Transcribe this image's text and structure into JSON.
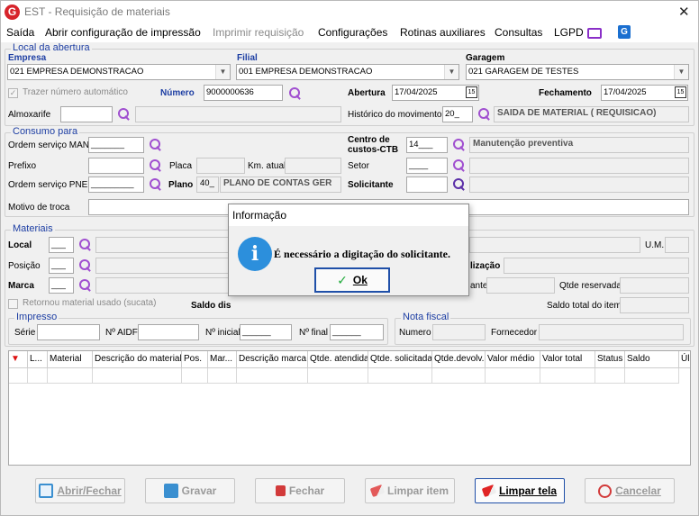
{
  "window": {
    "title": "EST - Requisição de materiais",
    "app_icon_letter": "G"
  },
  "menu": {
    "items": [
      "Saída",
      "Abrir configuração de impressão",
      "Imprimir requisição",
      "Configurações",
      "Rotinas auxiliares",
      "Consultas",
      "LGPD"
    ],
    "disabled": [
      "Imprimir requisição"
    ]
  },
  "local_abertura": {
    "legend": "Local da abertura",
    "empresa_label": "Empresa",
    "empresa_value": "021 EMPRESA DEMONSTRACAO",
    "filial_label": "Filial",
    "filial_value": "001 EMPRESA DEMONSTRACAO",
    "garagem_label": "Garagem",
    "garagem_value": "021 GARAGEM DE TESTES",
    "trazer_numero_label": "Trazer número automático",
    "trazer_numero_checked": true,
    "numero_label": "Número",
    "numero_value": "9000000636",
    "abertura_label": "Abertura",
    "abertura_value": "17/04/2025",
    "fechamento_label": "Fechamento",
    "fechamento_value": "17/04/2025",
    "calendar_day": "15",
    "almoxarife_label": "Almoxarife",
    "almoxarife_value": "",
    "historico_label": "Histórico do movimento",
    "historico_code": "20_",
    "historico_desc": "SAIDA DE MATERIAL ( REQUISICAO)"
  },
  "consumo": {
    "legend": "Consumo para",
    "os_man_label": "Ordem serviço MAN",
    "os_man_value": "_______",
    "centro_label_1": "Centro de",
    "centro_label_2": "custos-CTB",
    "centro_code": "14___",
    "centro_desc": "Manutenção preventiva",
    "prefixo_label": "Prefixo",
    "placa_label": "Placa",
    "km_label": "Km. atual",
    "setor_label": "Setor",
    "setor_value": "____",
    "os_pne_label": "Ordem serviço PNE",
    "os_pne_value": "_________",
    "plano_label": "Plano",
    "plano_code": "40_",
    "plano_desc": "PLANO DE CONTAS GER",
    "solicitante_label": "Solicitante",
    "motivo_label": "Motivo de troca"
  },
  "materiais": {
    "legend": "Materiais",
    "local_label": "Local",
    "local_value": "___",
    "um_label": "U.M.",
    "posicao_label": "Posição",
    "posicao_value": "___",
    "localizacao_label": "lização",
    "marca_label": "Marca",
    "marca_value": "___",
    "ante_label": "ante",
    "qtde_reservada_label": "Qtde reservada",
    "retornou_label": "Retornou material usado (sucata)",
    "saldo_label": "Saldo dis",
    "saldo_total_label": "Saldo total do item"
  },
  "impresso": {
    "legend": "Impresso",
    "serie_label": "Série",
    "aidf_label": "Nº AIDF",
    "inicial_label": "Nº inicial",
    "inicial_value": "______",
    "final_label": "Nº final",
    "final_value": "______"
  },
  "nota_fiscal": {
    "legend": "Nota fiscal",
    "numero_label": "Numero",
    "fornecedor_label": "Fornecedor"
  },
  "grid": {
    "columns": [
      "L...",
      "Material",
      "Descrição do material",
      "Pos.",
      "Mar...",
      "Descrição marca",
      "Qtde. atendida",
      "Qtde. solicitada",
      "Qtde.devolv.",
      "Valor médio",
      "Valor total",
      "Status",
      "Saldo",
      "Úl"
    ]
  },
  "buttons": {
    "abrir_fechar": "Abrir/Fechar",
    "gravar": "Gravar",
    "fechar": "Fechar",
    "limpar_item": "Limpar item",
    "limpar_tela": "Limpar tela",
    "cancelar": "Cancelar"
  },
  "dialog": {
    "title": "Informação",
    "message": "É necessário a digitação do solicitante.",
    "ok_label": "Ok",
    "icon": "info-icon"
  },
  "colors": {
    "legend": "#1d3ea3",
    "accent_purple": "#a04fd0",
    "info_blue": "#2c8fdc",
    "focus_border": "#1f4fa8"
  }
}
